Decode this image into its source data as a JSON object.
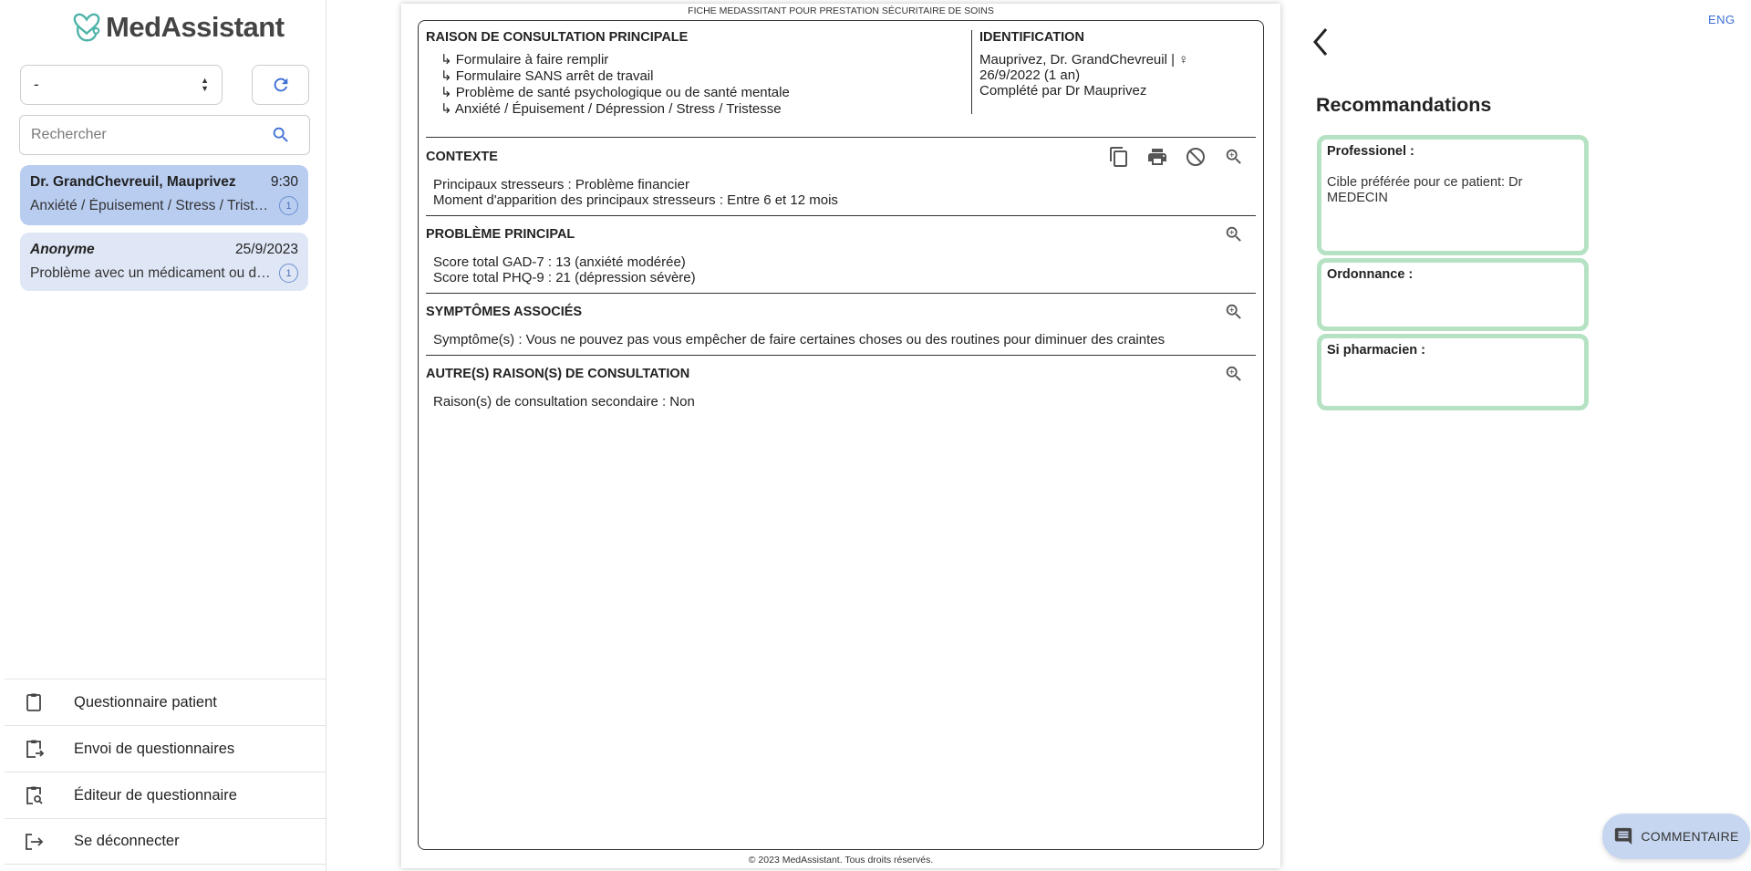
{
  "app": {
    "logo_text": "MedAssistant"
  },
  "sidebar": {
    "select_value": "-",
    "search_placeholder": "Rechercher",
    "conversations": [
      {
        "name": "Dr. GrandChevreuil, Mauprivez",
        "time": "9:30",
        "snippet": "Anxiété / Épuisement / Stress / Tristesse",
        "count": "1"
      },
      {
        "name": "Anonyme",
        "time": "25/9/2023",
        "snippet": "Problème avec un médicament ou des effets secondaires",
        "count": "1"
      }
    ],
    "nav": [
      {
        "label": "Questionnaire patient"
      },
      {
        "label": "Envoi de questionnaires"
      },
      {
        "label": "Éditeur de questionnaire"
      },
      {
        "label": "Se déconnecter"
      }
    ]
  },
  "document": {
    "header": "FICHE MEDASSITANT POUR PRESTATION SÉCURITAIRE DE SOINS",
    "footer": "© 2023 MedAssistant. Tous droits réservés.",
    "raison": {
      "title": "RAISON DE CONSULTATION PRINCIPALE",
      "items": [
        "↳ Formulaire à faire remplir",
        "↳ Formulaire SANS arrêt de travail",
        "↳ Problème de santé psychologique ou de santé mentale",
        "↳ Anxiété / Épuisement / Dépression / Stress / Tristesse"
      ]
    },
    "identification": {
      "title": "IDENTIFICATION",
      "line1": "Mauprivez, Dr. GrandChevreuil | ♀",
      "line2": "26/9/2022 (1 an)",
      "line3": "Complété par Dr Mauprivez"
    },
    "contexte": {
      "title": "CONTEXTE",
      "lines": [
        "Principaux stresseurs : Problème financier",
        "Moment d'apparition des principaux stresseurs : Entre 6 et 12 mois"
      ]
    },
    "probleme": {
      "title": "PROBLÈME PRINCIPAL",
      "lines": [
        "Score total GAD-7 : 13 (anxiété modérée)",
        "Score total PHQ-9 : 21 (dépression sévère)"
      ]
    },
    "symptomes": {
      "title": "SYMPTÔMES ASSOCIÉS",
      "lines": [
        "Symptôme(s) : Vous ne pouvez pas vous empêcher de faire certaines choses ou des routines pour diminuer des craintes"
      ]
    },
    "autres": {
      "title": "AUTRE(S) RAISON(S) DE CONSULTATION",
      "lines": [
        "Raison(s) de consultation secondaire : Non"
      ]
    }
  },
  "right": {
    "lang": "ENG",
    "reco_title": "Recommandations",
    "professionnel_label": "Professionel :",
    "professionnel_text": "Cible préférée pour ce patient: Dr MEDECIN",
    "ordonnance_label": "Ordonnance :",
    "pharmacien_label": "Si pharmacien :",
    "comment_label": "COMMENTAIRE"
  },
  "colors": {
    "accent": "#3d6fd6",
    "selected_conv": "#b9cdf1",
    "conv": "#dfe7f6",
    "reco_border": "#b6e2c4",
    "comment_btn": "#c7d6f0"
  },
  "icons": [
    "stethoscope-heart-logo-icon",
    "sort-arrows-icon",
    "refresh-icon",
    "search-icon",
    "clipboard-icon",
    "clipboard-send-icon",
    "clipboard-search-icon",
    "logout-icon",
    "copy-icon",
    "print-icon",
    "block-icon",
    "zoom-in-icon",
    "chevron-left-icon",
    "comment-icon"
  ]
}
